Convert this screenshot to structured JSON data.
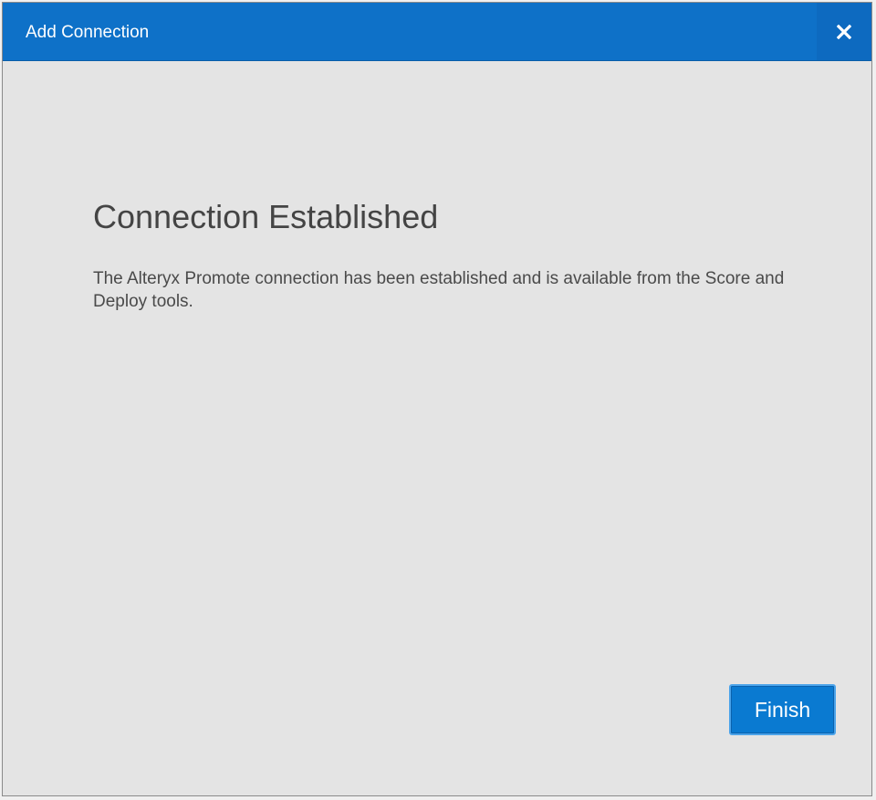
{
  "dialog": {
    "title": "Add Connection",
    "close_icon": "close-icon",
    "heading": "Connection Established",
    "message": "The Alteryx Promote connection has been established and is available from the Score and Deploy tools.",
    "finish_label": "Finish"
  },
  "colors": {
    "titlebar": "#0e71c8",
    "body": "#e4e4e4",
    "button": "#0a7ad1",
    "button_border": "#4aa3ea"
  }
}
